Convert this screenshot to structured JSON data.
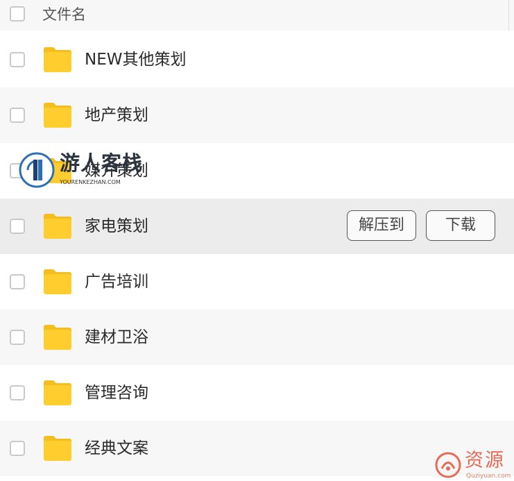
{
  "header": {
    "column_label": "文件名"
  },
  "files": [
    {
      "name": "NEW其他策划",
      "type": "folder"
    },
    {
      "name": "地产策划",
      "type": "folder"
    },
    {
      "name": "媒介策划",
      "type": "folder"
    },
    {
      "name": "家电策划",
      "type": "folder",
      "hovered": true,
      "actions": {
        "extract": "解压到",
        "download": "下载"
      }
    },
    {
      "name": "广告培训",
      "type": "folder"
    },
    {
      "name": "建材卫浴",
      "type": "folder"
    },
    {
      "name": "管理咨询",
      "type": "folder"
    },
    {
      "name": "经典文案",
      "type": "folder"
    }
  ],
  "watermarks": {
    "top": {
      "title": "游人客栈",
      "subtitle": "YOURENKEZHAN.COM"
    },
    "bottom": {
      "title": "资源",
      "subtitle": "Quziyuan.com"
    }
  },
  "colors": {
    "folder": "#FFCD2E",
    "folder_tab": "#F5BE1E",
    "row_alt": "#F7F7F7",
    "row_hover": "#ECECEC",
    "watermark_accent": "#E86A55"
  },
  "icons": {
    "folder": "folder-icon",
    "checkbox": "checkbox-icon"
  }
}
